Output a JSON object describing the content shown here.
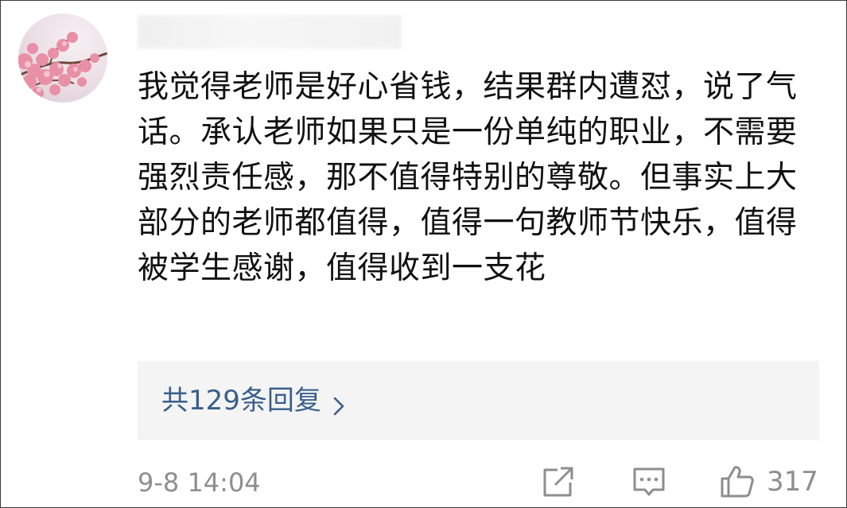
{
  "comment": {
    "text": "我觉得老师是好心省钱，结果群内遭怼，说了气话。承认老师如果只是一份单纯的职业，不需要强烈责任感，那不值得特别的尊敬。但事实上大部分的老师都值得，值得一句教师节快乐，值得被学生感谢，值得收到一支花",
    "replies_label": "共129条回复",
    "timestamp": "9-8 14:04",
    "like_count": "317"
  },
  "icons": {
    "avatar": "cherry-blossom-avatar",
    "share": "share-icon",
    "reply": "comment-icon",
    "like": "thumbs-up-icon",
    "chevron": "chevron-right-icon"
  },
  "colors": {
    "link": "#3a5f8a",
    "meta": "#8e8e8e",
    "text": "#111111",
    "reply_bg": "#f4f4f4"
  }
}
